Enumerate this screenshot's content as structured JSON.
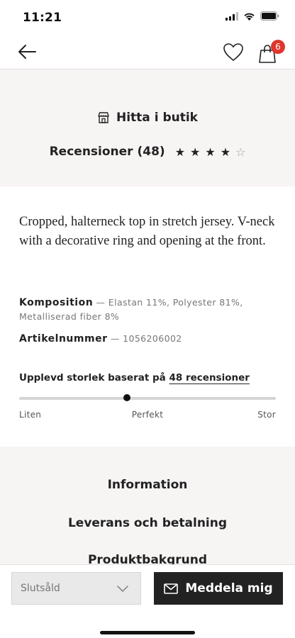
{
  "status_bar": {
    "time": "11:21"
  },
  "nav": {
    "back_icon": "arrow-left-icon",
    "favorite_icon": "heart-icon",
    "bag_icon": "shopping-bag-icon",
    "bag_count": "6",
    "badge_color": "#e0352b"
  },
  "store": {
    "icon": "store-icon",
    "label": "Hitta i butik"
  },
  "reviews": {
    "label": "Recensioner (48)",
    "rating": 4,
    "max_rating": 5,
    "filled_star": "★",
    "empty_star": "☆"
  },
  "product": {
    "description": "Cropped, halterneck top in stretch jersey. V-neck with a decorative ring and opening at the front.",
    "composition_label": "Komposition",
    "composition_value": " — Elastan 11%, Polyester 81%, Metalliserad fiber 8%",
    "article_label": "Artikelnummer",
    "article_value": " — 1056206002"
  },
  "fit": {
    "title_prefix": "Upplevd storlek baserat på ",
    "reviews_link": "48 recensioner",
    "scale_low": "Liten",
    "scale_mid": "Perfekt",
    "scale_high": "Stor",
    "position": 0.42
  },
  "info_menu": {
    "items": [
      "Information",
      "Leverans och betalning",
      "Produktbakgrund"
    ]
  },
  "actions": {
    "size_select_value": "Slutsåld",
    "notify_icon": "mail-icon",
    "notify_label": "Meddela mig",
    "button_color": "#222222",
    "section_background": "#f7f4f4"
  }
}
